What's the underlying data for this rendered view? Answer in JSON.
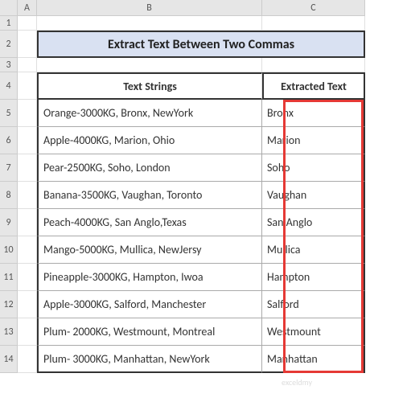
{
  "columns": [
    "A",
    "B",
    "C"
  ],
  "rowCount": 14,
  "title": "Extract Text Between Two Commas",
  "headers": {
    "b": "Text Strings",
    "c": "Extracted Text"
  },
  "rows": [
    {
      "b": "Orange-3000KG, Bronx, NewYork",
      "c": "Bronx"
    },
    {
      "b": "Apple-4000KG, Marion, Ohio",
      "c": "Marion"
    },
    {
      "b": "Pear-2500KG, Soho, London",
      "c": "Soho"
    },
    {
      "b": "Banana-3500KG, Vaughan, Toronto",
      "c": "Vaughan"
    },
    {
      "b": "Peach-4000KG, San Anglo,Texas",
      "c": "San Anglo"
    },
    {
      "b": "Mango-5000KG, Mullica, NewJersy",
      "c": "Mullica"
    },
    {
      "b": "Pineapple-3000KG, Hampton, Iwoa",
      "c": "Hampton"
    },
    {
      "b": "Apple-3000KG, Salford, Manchester",
      "c": "Salford"
    },
    {
      "b": "Plum- 2000KG, Westmount, Montreal",
      "c": "Westmount"
    },
    {
      "b": "Plum- 3000KG, Manhattan, NewYork",
      "c": "Manhattan"
    }
  ],
  "chart_data": {
    "type": "table",
    "title": "Extract Text Between Two Commas",
    "columns": [
      "Text Strings",
      "Extracted Text"
    ],
    "data": [
      [
        "Orange-3000KG, Bronx, NewYork",
        "Bronx"
      ],
      [
        "Apple-4000KG, Marion, Ohio",
        "Marion"
      ],
      [
        "Pear-2500KG, Soho, London",
        "Soho"
      ],
      [
        "Banana-3500KG, Vaughan, Toronto",
        "Vaughan"
      ],
      [
        "Peach-4000KG, San Anglo,Texas",
        "San Anglo"
      ],
      [
        "Mango-5000KG, Mullica, NewJersy",
        "Mullica"
      ],
      [
        "Pineapple-3000KG, Hampton, Iwoa",
        "Hampton"
      ],
      [
        "Apple-3000KG, Salford, Manchester",
        "Salford"
      ],
      [
        "Plum- 2000KG, Westmount, Montreal",
        "Westmount"
      ],
      [
        "Plum- 3000KG, Manhattan, NewYork",
        "Manhattan"
      ]
    ]
  }
}
